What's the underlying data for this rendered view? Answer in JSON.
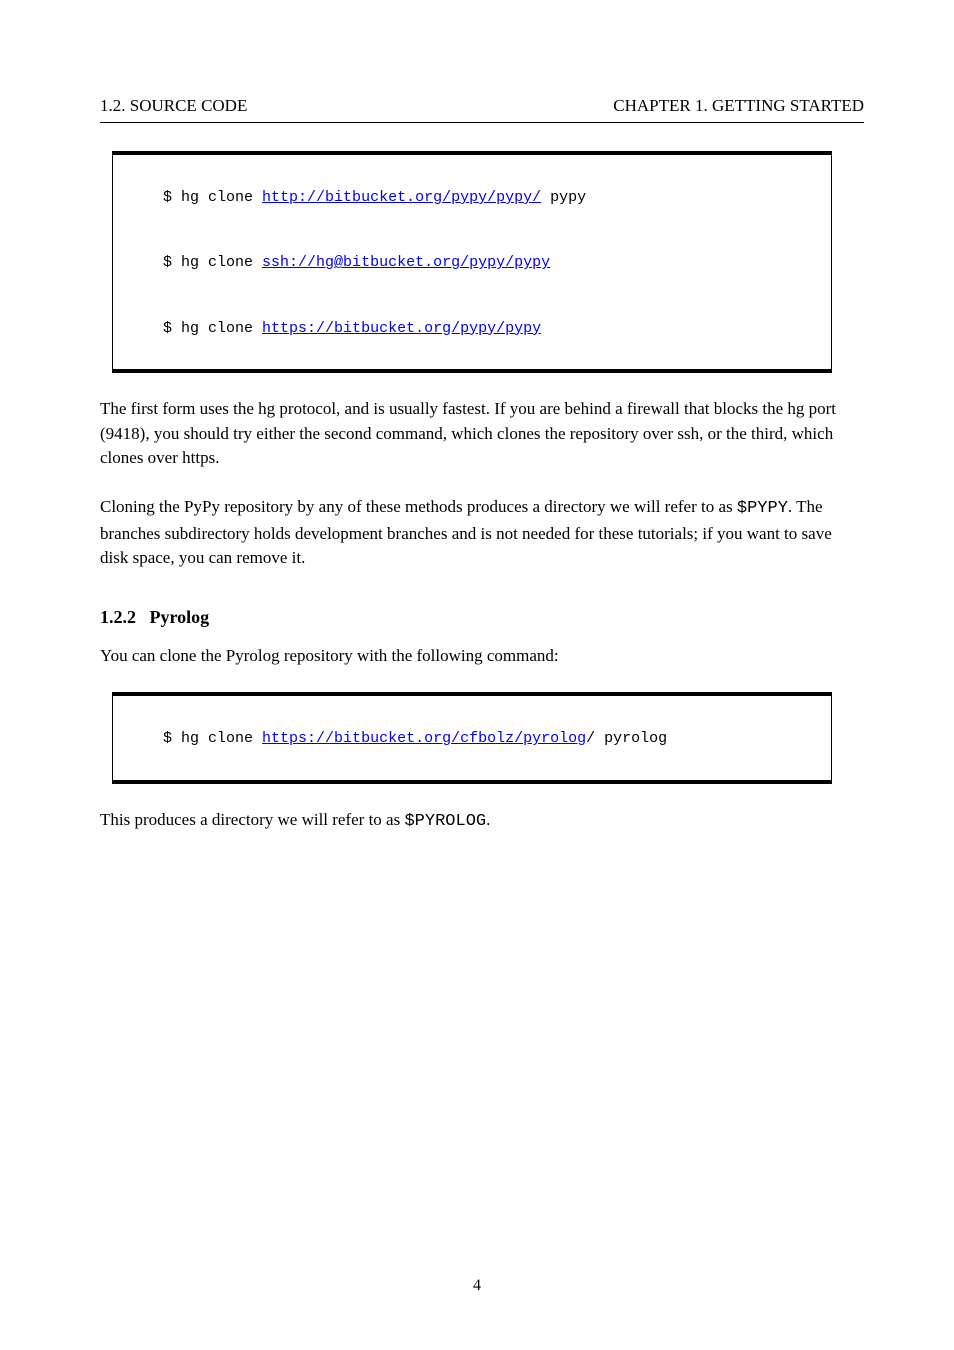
{
  "header": {
    "left": "1.2. SOURCE CODE",
    "right": "CHAPTER 1. GETTING STARTED"
  },
  "box1": {
    "lines": {
      "pre0a": "$ hg clone ",
      "link0": "http://bitbucket.org/pypy/pypy/",
      "post0a": " pypy",
      "pre1a": "$ hg clone ",
      "link1": "ssh://hg@bitbucket.org/pypy/pypy",
      "post1a": "",
      "pre2a": "$ hg clone ",
      "link2": "https://bitbucket.org/pypy/pypy",
      "post2a": ""
    }
  },
  "para1": "The first form uses the hg protocol, and is usually fastest. If you are behind a firewall that blocks the hg port (9418), you should try either the second command, which clones the repository over ssh, or the third, which clones over https.",
  "para2_pre": "Cloning the PyPy repository by any of these methods produces a directory we will refer to as ",
  "para2_mono": "$PYPY",
  "para2_post": ". The branches subdirectory holds development branches and is not needed for these tutorials; if you want to save disk space, you can remove it.",
  "section": {
    "num": "1.2.2",
    "title": "Pyrolog",
    "body": "You can clone the Pyrolog repository with the following command:"
  },
  "box2": {
    "lines": {
      "pre0a": "$ hg clone ",
      "link0": "https://bitbucket.org/cfbolz/pyrolog",
      "post0a": "/ pyrolog"
    }
  },
  "para3_pre": "This produces a directory we will refer to as ",
  "para3_mono": "$PYROLOG",
  "para3_post": ".",
  "footer": {
    "page": "4"
  }
}
